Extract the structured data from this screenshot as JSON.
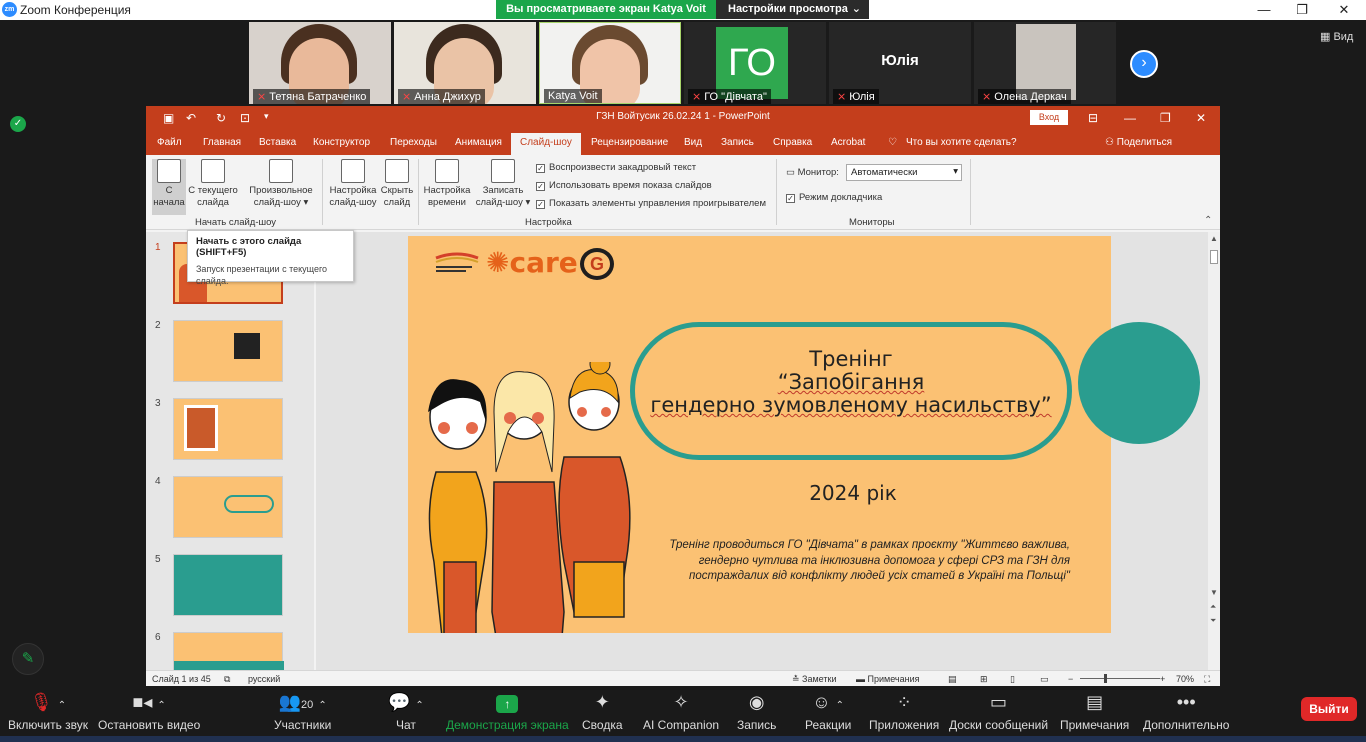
{
  "zoom": {
    "window_title": "Zoom Конференция",
    "share_banner": "Вы просматриваете экран Katya Voit",
    "view_settings": "Настройки просмотра",
    "view_button": "Вид",
    "participants": [
      {
        "name": "Тетяна Батраченко"
      },
      {
        "name": "Анна Джихур"
      },
      {
        "name": "Katya Voit"
      },
      {
        "name": "ГО \"Дівчата\"",
        "avatar_text": "ГО"
      },
      {
        "name": "Юлія",
        "avatar_text": "Юлія"
      },
      {
        "name": "Олена Деркач"
      }
    ],
    "controls": {
      "unmute": "Включить звук",
      "stop_video": "Остановить видео",
      "participants": "Участники",
      "participants_count": "20",
      "chat": "Чат",
      "share_screen": "Демонстрация экрана",
      "summary": "Сводка",
      "ai_companion": "AI Companion",
      "record": "Запись",
      "reactions": "Реакции",
      "apps": "Приложения",
      "whiteboards": "Доски сообщений",
      "notes": "Примечания",
      "more": "Дополнительно",
      "leave": "Выйти"
    }
  },
  "ppt": {
    "title": "ГЗН Войтусик 26.02.24 1  -  PowerPoint",
    "login": "Вход",
    "tabs": [
      "Файл",
      "Главная",
      "Вставка",
      "Конструктор",
      "Переходы",
      "Анимация",
      "Слайд-шоу",
      "Рецензирование",
      "Вид",
      "Запись",
      "Справка",
      "Acrobat"
    ],
    "tell_me": "Что вы хотите сделать?",
    "share": "Поделиться",
    "ribbon": {
      "from_start_l1": "С",
      "from_start_l2": "начала",
      "from_current_l1": "С текущего",
      "from_current_l2": "слайда",
      "custom_l1": "Произвольное",
      "custom_l2": "слайд-шоу",
      "setup_l1": "Настройка",
      "setup_l2": "слайд-шоу",
      "hide_l1": "Скрыть",
      "hide_l2": "слайд",
      "rehearse_l1": "Настройка",
      "rehearse_l2": "времени",
      "record_l1": "Записать",
      "record_l2": "слайд-шоу",
      "chk_narration": "Воспроизвести закадровый текст",
      "chk_timings": "Использовать время показа слайдов",
      "chk_controls": "Показать элементы управления проигрывателем",
      "monitor_label": "Монитор:",
      "monitor_value": "Автоматически",
      "presenter_view": "Режим докладчика",
      "group_start": "Начать слайд-шоу",
      "group_setup": "Настройка",
      "group_monitors": "Мониторы"
    },
    "tooltip": {
      "title": "Начать с этого слайда (SHIFT+F5)",
      "body": "Запуск презентации с текущего слайда."
    },
    "thumbnails": [
      "1",
      "2",
      "3",
      "4",
      "5",
      "6"
    ],
    "slide": {
      "title_line1": "Тренінг",
      "title_line2": "“Запобігання",
      "title_line3": "гендерно зумовленому насильству”",
      "year": "2024 рік",
      "description": "Тренінг проводиться ГО \"Дівчата\"  в рамках проєкту \"Життєво важлива, гендерно чутлива та інклюзивна допомога у сфері СРЗ та ГЗН для постраждалих від конфлікту людей усіх статей в Україні та Польщі\"",
      "logo_care": "care",
      "logo_g": "G"
    },
    "status": {
      "slide_counter": "Слайд 1 из 45",
      "language": "русский",
      "notes": "Заметки",
      "comments": "Примечания",
      "zoom": "70%"
    }
  },
  "colors": {
    "ppt_accent": "#c43e1c",
    "zoom_green": "#1ba64a",
    "slide_bg": "#fbc173",
    "slide_teal": "#2a9d8f",
    "leave_red": "#e02828"
  }
}
